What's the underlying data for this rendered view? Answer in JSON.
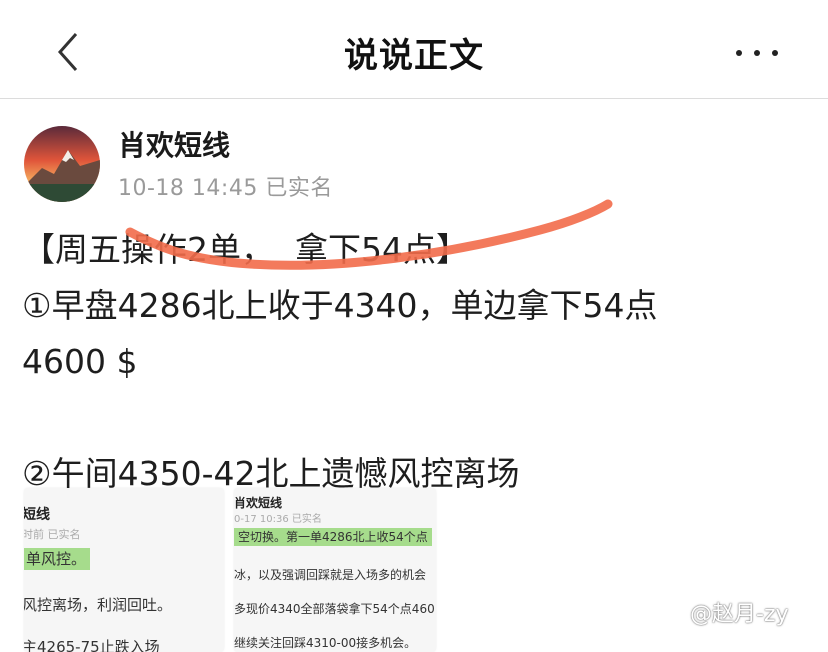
{
  "nav": {
    "title": "说说正文",
    "back_icon": "chevron-left-icon",
    "more_icon": "more-horizontal-icon"
  },
  "post": {
    "author": "肖欢短线",
    "time": "10-18 14:45",
    "verified_label": "已实名",
    "body": "【周五操作2单，  拿下54点】\n①早盘4286北上收于4340，单边拿下54点\n4600 $\n\n②午间4350-42北上遗憾风控离场"
  },
  "attachments": [
    {
      "name": "短线",
      "sub": "时前 已实名",
      "lines": [
        "单风控。",
        "风控离场，利润回吐。",
        "主4265-75止跌入场"
      ]
    },
    {
      "name": "肖欢短线",
      "sub": "0-17 10:36 已实名",
      "lines": [
        "空切换。第一单4286北上收54个点",
        "冰，以及强调回踩就是入场多的机会",
        "多现价4340全部落袋拿下54个点460",
        "继续关注回踩4310-00接多机会。"
      ]
    }
  ],
  "watermark": "@赵月-zy",
  "colors": {
    "highlight": "#a6dc8c",
    "annotation_stroke": "#f26b4a"
  }
}
